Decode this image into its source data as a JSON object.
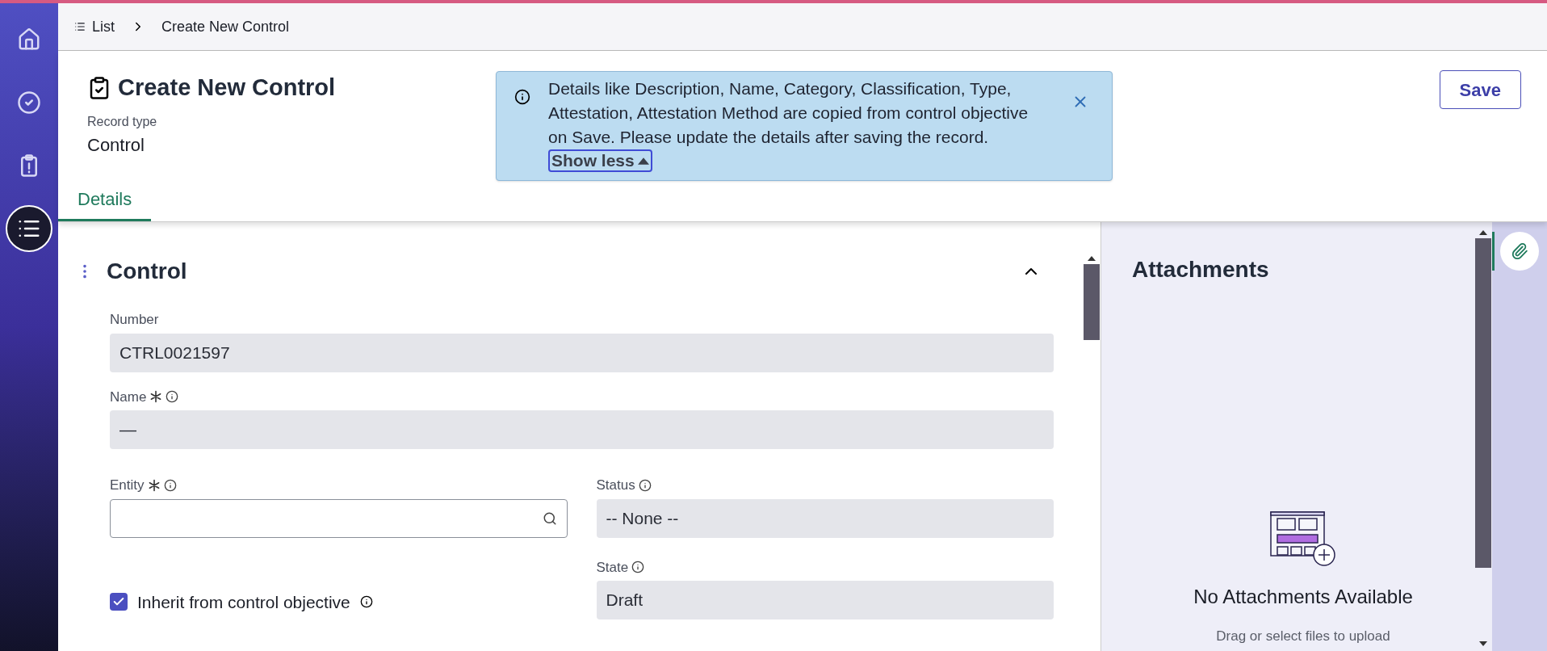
{
  "nav_items": [
    {
      "kind": "home",
      "selected": false
    },
    {
      "kind": "check",
      "selected": false
    },
    {
      "kind": "clipboard",
      "selected": false
    },
    {
      "kind": "list",
      "selected": true
    }
  ],
  "breadcrumb": [
    {
      "label": "List"
    },
    {
      "label": "Create New Control"
    }
  ],
  "header": {
    "title": "Create New Control",
    "record_type_label": "Record type",
    "record_type_value": "Control",
    "save_button": "Save"
  },
  "tabs": [
    {
      "label": "Details",
      "selected": true
    }
  ],
  "notification": {
    "message": "Details like Description, Name, Category, Classification, Type, Attestation, Attestation Method are copied from control objective on Save. Please update the details after saving the record.",
    "toggle": "Show less"
  },
  "section": {
    "title": "Control",
    "expanded": true
  },
  "fields": [
    {
      "label": "Number",
      "value": "CTRL0021597",
      "required": false,
      "info": false,
      "kind": "readonly"
    },
    {
      "label": "Name",
      "value": "—",
      "required": true,
      "info": true,
      "kind": "readonly"
    }
  ],
  "pair": [
    {
      "label": "Entity",
      "required": true,
      "info": true,
      "kind": "search"
    },
    {
      "label": "Status",
      "value": "-- None --",
      "required": false,
      "info": true,
      "kind": "readonly"
    }
  ],
  "checkbox": {
    "label": "Inherit from control objective",
    "checked": true,
    "info": true
  },
  "state_field": {
    "label": "State",
    "value": "Draft",
    "required": false,
    "info": true,
    "kind": "readonly"
  },
  "attachments": {
    "title": "Attachments",
    "empty_title": "No Attachments Available",
    "empty_hint": "Drag or select files to upload"
  }
}
